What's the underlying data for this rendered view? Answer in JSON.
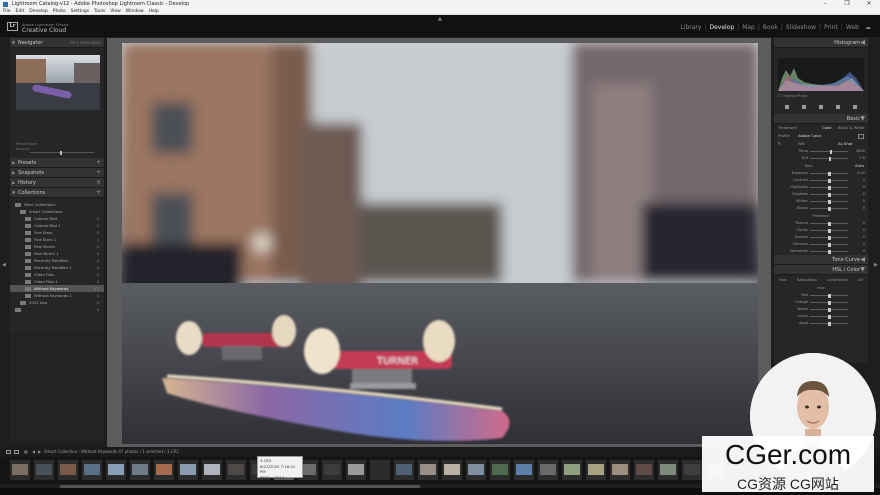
{
  "window": {
    "title": "Lightroom Catalog-v12 - Adobe Photoshop Lightroom Classic - Develop",
    "controls": [
      "–",
      "❐",
      "✕"
    ]
  },
  "menu": [
    "File",
    "Edit",
    "Develop",
    "Photo",
    "Settings",
    "Tools",
    "View",
    "Window",
    "Help"
  ],
  "identity": {
    "badge": "Lr",
    "line1": "Adobe Lightroom Classic",
    "line2": "Creative Cloud"
  },
  "modules": [
    "Library",
    "Develop",
    "Map",
    "Book",
    "Slideshow",
    "Print",
    "Web"
  ],
  "active_module": "Develop",
  "left_panel": {
    "navigator": {
      "title": "Navigator",
      "zoom_options": "FIT  1  100%  200%"
    },
    "preview_info": [
      "Preset  None",
      "Amount"
    ],
    "sections": [
      "Presets",
      "Snapshots",
      "History",
      "Collections"
    ],
    "collections": [
      {
        "label": "Filter Collections",
        "count": "",
        "indent": 1
      },
      {
        "label": "Smart Collections",
        "count": "",
        "indent": 2
      },
      {
        "label": "Colored Red",
        "count": "0",
        "indent": 3
      },
      {
        "label": "Colored Red 1",
        "count": "1",
        "indent": 3
      },
      {
        "label": "Five Stars",
        "count": "0",
        "indent": 3
      },
      {
        "label": "Five Stars 1",
        "count": "1",
        "indent": 3
      },
      {
        "label": "Past Month",
        "count": "0",
        "indent": 3
      },
      {
        "label": "Past Month 1",
        "count": "0",
        "indent": 3
      },
      {
        "label": "Recently Modified",
        "count": "0",
        "indent": 3
      },
      {
        "label": "Recently Modified 1",
        "count": "0",
        "indent": 3
      },
      {
        "label": "Video Files",
        "count": "0",
        "indent": 3
      },
      {
        "label": "Video Files 1",
        "count": "0",
        "indent": 3
      },
      {
        "label": "Without Keywords",
        "count": "47",
        "indent": 3,
        "selected": true
      },
      {
        "label": "Without Keywords 1",
        "count": "0",
        "indent": 3
      },
      {
        "label": "2022 test",
        "count": "0",
        "indent": 2
      },
      {
        "label": "",
        "count": "0",
        "indent": 1
      }
    ]
  },
  "right_panel": {
    "histogram_title": "Histogram",
    "original_photo": "Original Photo",
    "basic_title": "Basic",
    "treatment": [
      "Treatment",
      "Color",
      "Black & White"
    ],
    "profile": [
      "Profile",
      "Adobe Color"
    ],
    "wb": [
      "WB",
      "As Shot"
    ],
    "temp_tint": [
      {
        "label": "Temp",
        "value": "4800",
        "pos": 0.55
      },
      {
        "label": "Tint",
        "value": "+ 6",
        "pos": 0.52
      }
    ],
    "tone_label": "Tone",
    "tone_auto": "Auto",
    "tone_sliders": [
      {
        "label": "Exposure",
        "value": "0.00",
        "pos": 0.5
      },
      {
        "label": "Contrast",
        "value": "0",
        "pos": 0.5
      },
      {
        "label": "Highlights",
        "value": "0",
        "pos": 0.5
      },
      {
        "label": "Shadows",
        "value": "0",
        "pos": 0.5
      },
      {
        "label": "Whites",
        "value": "0",
        "pos": 0.5
      },
      {
        "label": "Blacks",
        "value": "0",
        "pos": 0.5
      }
    ],
    "presence_label": "Presence",
    "presence_sliders": [
      {
        "label": "Texture",
        "value": "0",
        "pos": 0.5
      },
      {
        "label": "Clarity",
        "value": "0",
        "pos": 0.5
      },
      {
        "label": "Dehaze",
        "value": "0",
        "pos": 0.5
      },
      {
        "label": "Vibrance",
        "value": "0",
        "pos": 0.5
      },
      {
        "label": "Saturation",
        "value": "0",
        "pos": 0.5
      }
    ],
    "tone_curve": "Tone Curve",
    "hsl_title": "HSL / Color",
    "hsl_tabs": [
      "Hue",
      "Saturation",
      "Luminance",
      "All"
    ],
    "hsl_hue": "Hue",
    "hsl_rows": [
      "Red",
      "Orange",
      "Yellow",
      "Green",
      "Aqua"
    ]
  },
  "filmstrip_bar": {
    "crumb": "Smart Collection : Without Keywords   47 photos / 1 selected / 3.CR2"
  },
  "tooltip": [
    "3.CR2",
    "8/23/2020 7:16:41 PM",
    "3655 x 3744"
  ],
  "filmstrip": {
    "thumbs": [
      {
        "color": "#7a6e63"
      },
      {
        "color": "#4a5058"
      },
      {
        "color": "#7b5a4a"
      },
      {
        "color": "#5a6f86"
      },
      {
        "color": "#8aa0b8"
      },
      {
        "color": "#6f7a87"
      },
      {
        "color": "#a36a4e"
      },
      {
        "color": "#8a9aaf"
      },
      {
        "color": "#b0b4bb"
      },
      {
        "color": "#4f4a48"
      },
      {
        "color": "#3a3a3a"
      },
      {
        "color": "#5a5a5a",
        "selected": true
      },
      {
        "color": "#6b6b6b"
      },
      {
        "color": "#3c3c3c"
      },
      {
        "color": "#9a9a9a"
      },
      {
        "color": "#2a2a2a"
      },
      {
        "color": "#4f5f72"
      },
      {
        "color": "#9a8f86"
      },
      {
        "color": "#b9b1a3"
      },
      {
        "color": "#7f8f9f"
      },
      {
        "color": "#4f6a4e"
      },
      {
        "color": "#5a7fa8"
      },
      {
        "color": "#6a6a6a"
      },
      {
        "color": "#8f9f7f"
      },
      {
        "color": "#a7a27f"
      },
      {
        "color": "#9d8f80"
      },
      {
        "color": "#5f4a4a"
      },
      {
        "color": "#7f8a7a"
      },
      {
        "color": "#3f3f3f"
      },
      {
        "color": "#8f7f6f"
      }
    ]
  },
  "watermark": {
    "big": "CGer.com",
    "sub": "CG资源  CG网站"
  },
  "colors": {
    "accent_selected": "#555555",
    "panel_bg": "#262626",
    "skateboard_deck": "#b54056",
    "wheels": "#e8dcc8"
  }
}
